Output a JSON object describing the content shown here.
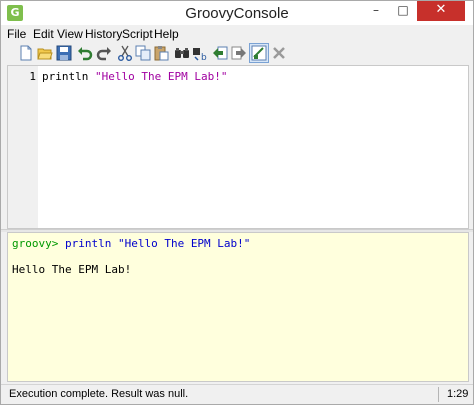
{
  "window": {
    "title": "GroovyConsole",
    "app_icon_glyph": "G",
    "controls": {
      "minimize": "–",
      "maximize": "□",
      "close": "✕"
    }
  },
  "menu": [
    "File",
    "Edit",
    "View",
    "History",
    "Script",
    "Help"
  ],
  "toolbar": {
    "icons": [
      "new-document-icon",
      "open-folder-icon",
      "save-icon",
      "undo-icon",
      "redo-icon",
      "cut-icon",
      "copy-icon",
      "paste-icon",
      "find-icon",
      "replace-icon",
      "history-previous-icon",
      "history-next-icon",
      "clear-output-icon",
      "run-script-icon",
      "interrupt-icon"
    ]
  },
  "editor": {
    "line_number": "1",
    "code_keyword": "println",
    "code_string": "\"Hello The EPM Lab!\""
  },
  "output": {
    "prompt": "groovy>",
    "echo": "println \"Hello The EPM Lab!\"",
    "result": "Hello The EPM Lab!"
  },
  "status": {
    "message": "Execution complete. Result was null.",
    "caret": "1:29"
  },
  "colors": {
    "output_background": "#ffffdd",
    "string_literal": "#a000a0",
    "prompt": "#009900",
    "echo": "#0000cc",
    "close_button": "#c7302b"
  }
}
